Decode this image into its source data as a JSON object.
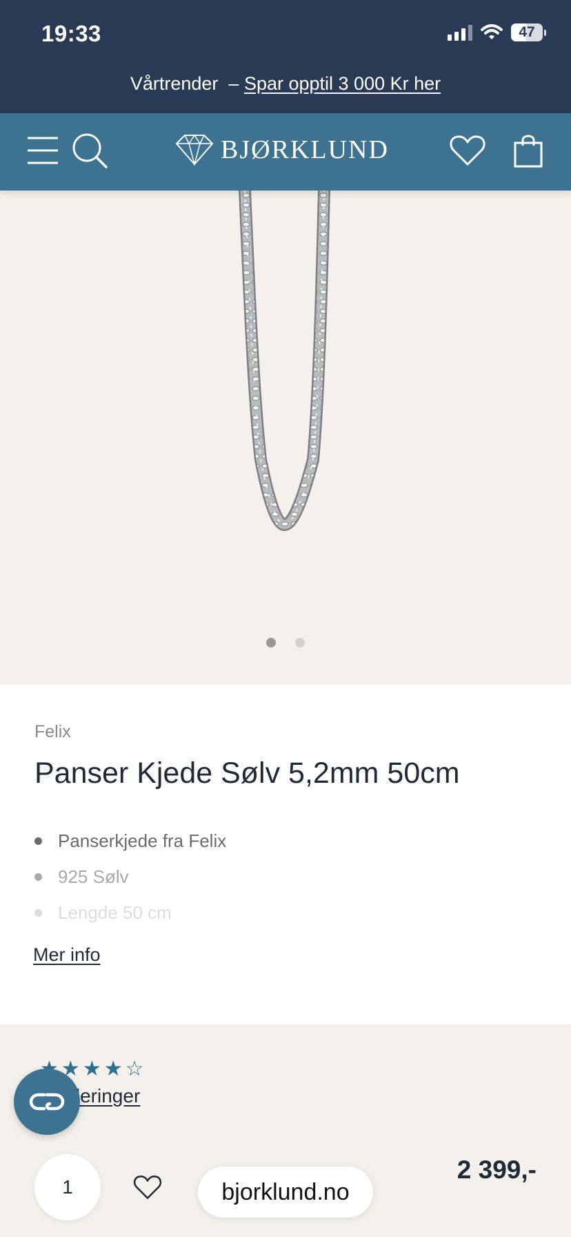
{
  "status_bar": {
    "time": "19:33",
    "battery": "47",
    "battery_level": 0.47
  },
  "promo": {
    "prefix": "Vårtrender  – ",
    "link": "Spar opptil 3 000 Kr her"
  },
  "header": {
    "logo_text": "BJØRKLUND",
    "icons": [
      "menu-icon",
      "search-icon",
      "diamond-logo-icon",
      "heart-icon",
      "shopping-bag-icon"
    ]
  },
  "gallery": {
    "image_count": 2,
    "active_index": 0
  },
  "product": {
    "brand": "Felix",
    "title": "Panser Kjede Sølv 5,2mm 50cm",
    "features": [
      {
        "text": "Panserkjede fra Felix",
        "color": "#6b6b6b"
      },
      {
        "text": "925 Sølv",
        "color": "#a9a9a9"
      },
      {
        "text": "Lengde 50 cm",
        "color": "#dcdcdc"
      }
    ],
    "more_info": "Mer info"
  },
  "reviews": {
    "rating": 4,
    "max": 5,
    "link": "Vurderinger"
  },
  "purchase": {
    "quantity": "1",
    "price": "2 399,-"
  },
  "browser": {
    "url": "bjorklund.no"
  },
  "colors": {
    "status_bg": "#293b54",
    "header_bg": "#3d7390",
    "beige": "#f4f1ec",
    "star": "#2f6e8e"
  }
}
